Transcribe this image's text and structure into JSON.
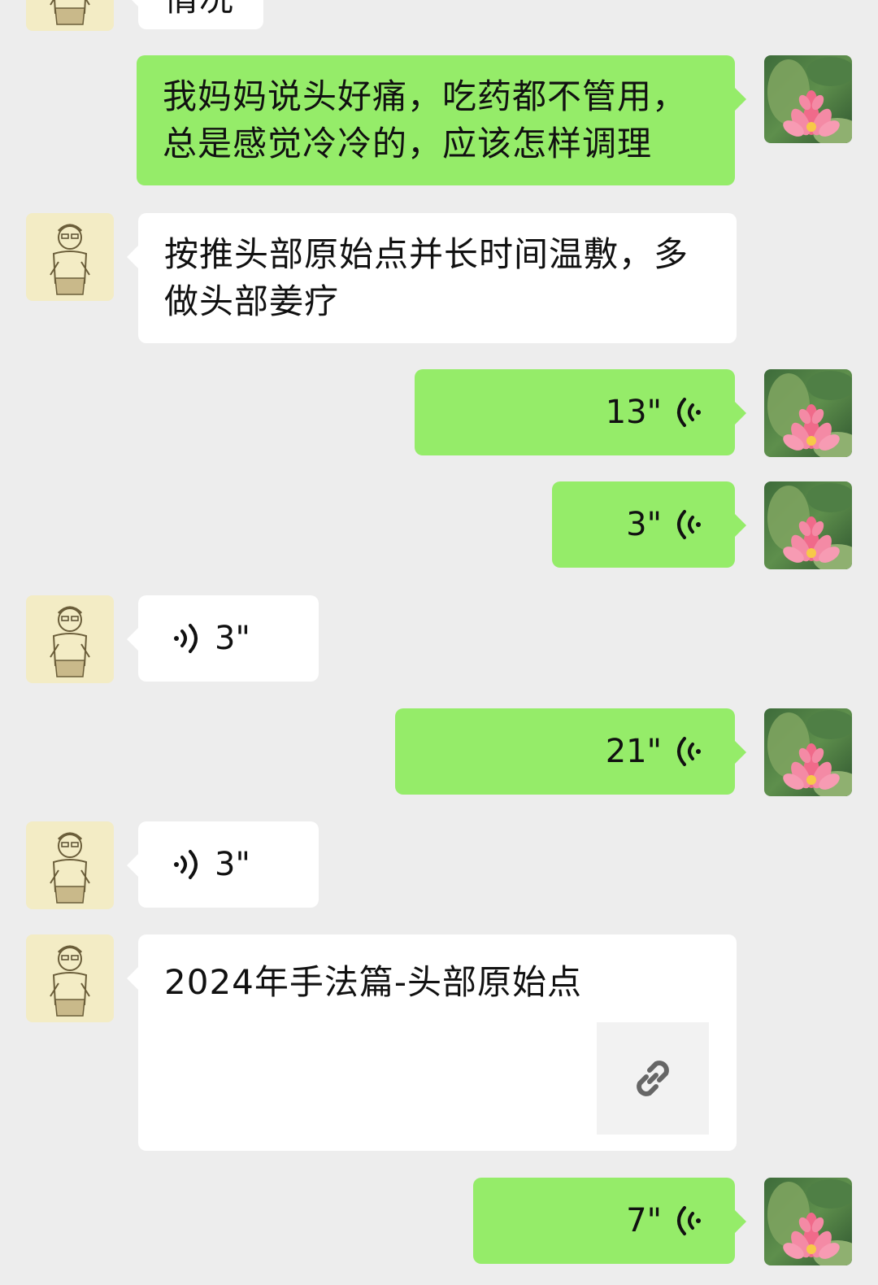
{
  "messages": [
    {
      "sender": "other",
      "type": "text",
      "text": "情况"
    },
    {
      "sender": "me",
      "type": "text",
      "text": "我妈妈说头好痛，吃药都不管用，总是感觉冷冷的，应该怎样调理"
    },
    {
      "sender": "other",
      "type": "text",
      "text": "按推头部原始点并长时间温敷，多做头部姜疗"
    },
    {
      "sender": "me",
      "type": "voice",
      "duration": "13\""
    },
    {
      "sender": "me",
      "type": "voice",
      "duration": "3\""
    },
    {
      "sender": "other",
      "type": "voice",
      "duration": "3\""
    },
    {
      "sender": "me",
      "type": "voice",
      "duration": "21\""
    },
    {
      "sender": "other",
      "type": "voice",
      "duration": "3\""
    },
    {
      "sender": "other",
      "type": "link",
      "title": "2024年手法篇-头部原始点",
      "icon": "link-icon"
    },
    {
      "sender": "me",
      "type": "voice",
      "duration": "7\""
    }
  ],
  "colors": {
    "background": "#ededed",
    "sent_bubble": "#95ec69",
    "received_bubble": "#ffffff"
  }
}
